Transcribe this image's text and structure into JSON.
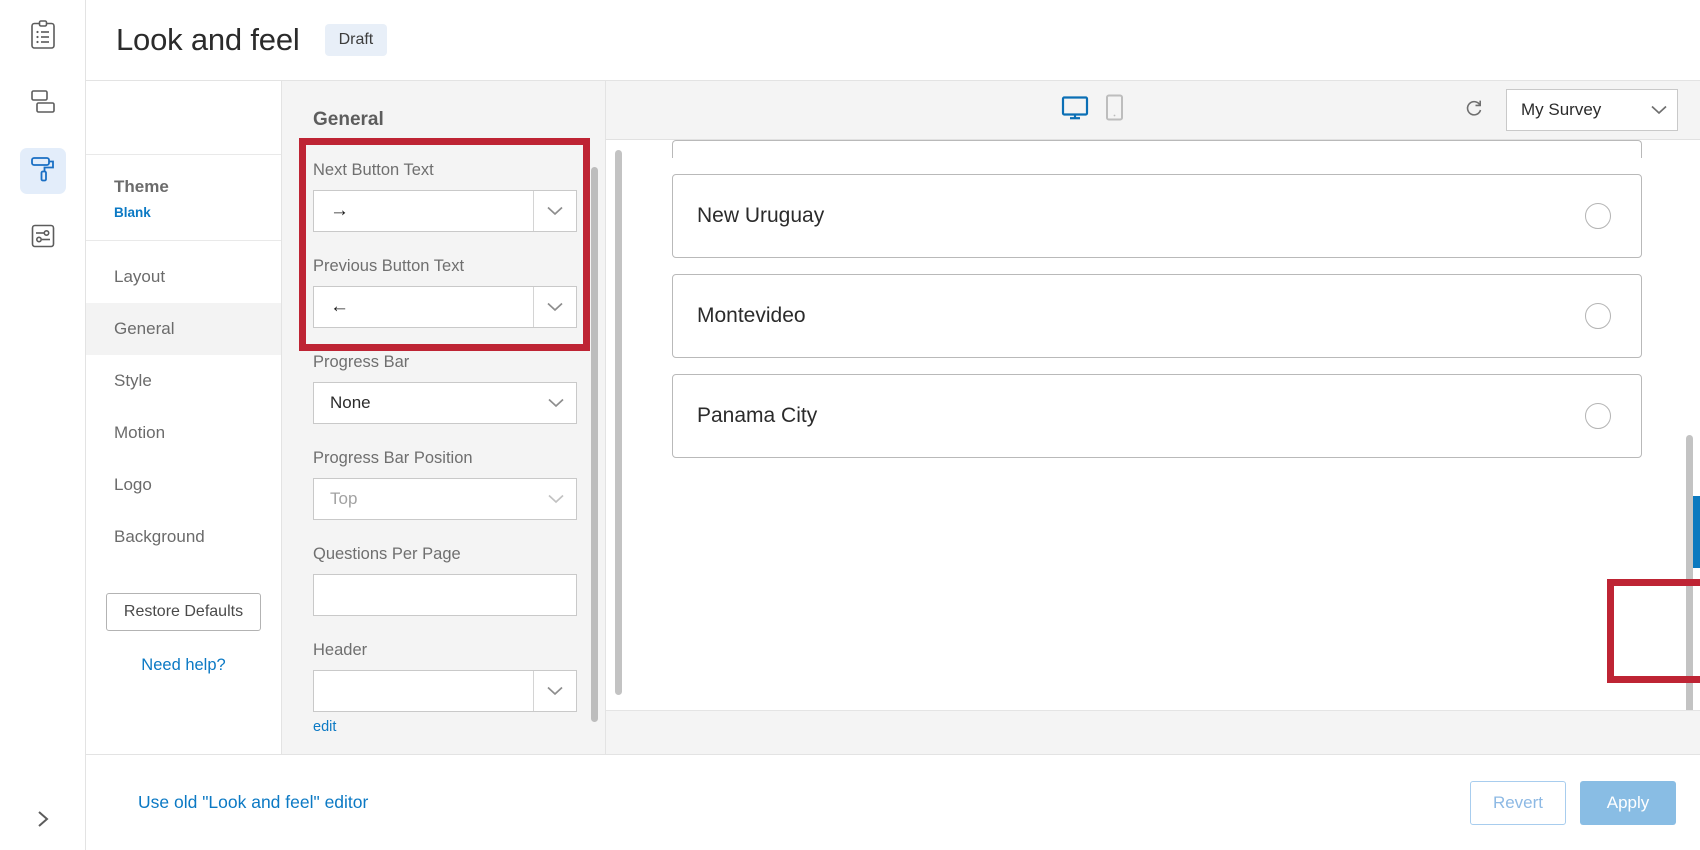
{
  "rail": {
    "items": [
      {
        "name": "survey-builder",
        "icon": "clipboard-list-icon",
        "active": false
      },
      {
        "name": "survey-flow",
        "icon": "flow-blocks-icon",
        "active": false
      },
      {
        "name": "look-and-feel",
        "icon": "paint-roller-icon",
        "active": true
      },
      {
        "name": "survey-options",
        "icon": "sliders-settings-icon",
        "active": false
      }
    ],
    "expand_icon": "chevron-right-icon"
  },
  "header": {
    "title": "Look and feel",
    "status_badge": "Draft"
  },
  "nav": {
    "theme_label": "Theme",
    "theme_value": "Blank",
    "items": [
      {
        "label": "Layout",
        "active": false
      },
      {
        "label": "General",
        "active": true
      },
      {
        "label": "Style",
        "active": false
      },
      {
        "label": "Motion",
        "active": false
      },
      {
        "label": "Logo",
        "active": false
      },
      {
        "label": "Background",
        "active": false
      }
    ],
    "restore_defaults": "Restore Defaults",
    "need_help": "Need help?"
  },
  "settings": {
    "title": "General",
    "fields": {
      "next_button_text": {
        "label": "Next Button Text",
        "value": "→"
      },
      "previous_button_text": {
        "label": "Previous Button Text",
        "value": "←"
      },
      "progress_bar": {
        "label": "Progress Bar",
        "value": "None"
      },
      "progress_bar_position": {
        "label": "Progress Bar Position",
        "value": "Top"
      },
      "questions_per_page": {
        "label": "Questions Per Page",
        "value": "",
        "placeholder": ""
      },
      "header": {
        "label": "Header",
        "value": "",
        "edit_link": "edit"
      }
    }
  },
  "preview": {
    "toolbar": {
      "desktop_icon": "desktop-monitor-icon",
      "mobile_icon": "mobile-phone-icon",
      "refresh_icon": "refresh-icon",
      "survey_selected": "My Survey"
    },
    "options": [
      {
        "label": "New Uruguay",
        "selected": false
      },
      {
        "label": "Montevideo",
        "selected": false
      },
      {
        "label": "Panama City",
        "selected": false
      }
    ],
    "next_button_label": "→"
  },
  "bottom": {
    "old_editor_link": "Use old \"Look and feel\" editor",
    "revert": "Revert",
    "apply": "Apply"
  },
  "colors": {
    "accent_blue": "#0b79bf",
    "link_blue": "#0b79c4",
    "highlight_red": "#be2434",
    "rail_active_bg": "#e3edfa",
    "panel_bg": "#f4f4f4"
  }
}
